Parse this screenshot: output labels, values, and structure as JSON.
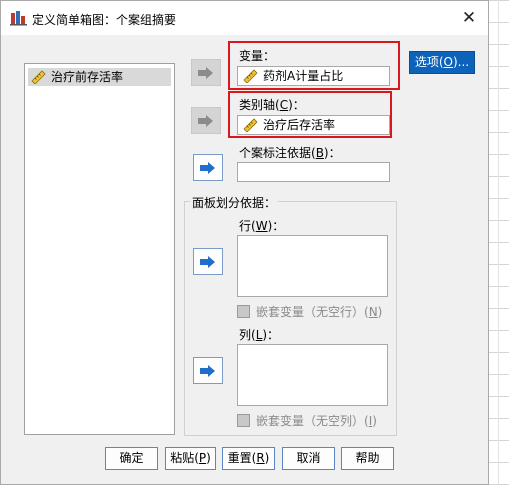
{
  "window": {
    "title": "定义简单箱图：个案组摘要",
    "close_glyph": "✕"
  },
  "source_list": {
    "items": [
      {
        "label": "治疗前存活率",
        "icon": "ruler-icon"
      }
    ]
  },
  "variable": {
    "label": "变量：",
    "value": "药剂A计量占比"
  },
  "category_axis": {
    "label_prefix": "类别轴(",
    "label_key": "C",
    "label_suffix": ")：",
    "value": "治疗后存活率"
  },
  "case_label": {
    "label_prefix": "个案标注依据(",
    "label_key": "B",
    "label_suffix": ")：",
    "value": ""
  },
  "panel": {
    "title": "面板划分依据：",
    "row": {
      "label_prefix": "行(",
      "label_key": "W",
      "label_suffix": ")："
    },
    "row_nest": {
      "label": "嵌套变量（无空行）(",
      "key": "N",
      "suffix": ")"
    },
    "col": {
      "label_prefix": "列(",
      "label_key": "L",
      "label_suffix": ")："
    },
    "col_nest": {
      "label": "嵌套变量（无空列）(",
      "key": "I",
      "suffix": ")"
    }
  },
  "buttons": {
    "options": {
      "prefix": "选项(",
      "key": "O",
      "suffix": ")..."
    },
    "ok": "确定",
    "paste": {
      "prefix": "粘贴(",
      "key": "P",
      "suffix": ")"
    },
    "reset": {
      "prefix": "重置(",
      "key": "R",
      "suffix": ")"
    },
    "cancel": "取消",
    "help": "帮助"
  },
  "colors": {
    "highlight_box": "#d8181c",
    "accent_blue": "#0c63b9"
  }
}
